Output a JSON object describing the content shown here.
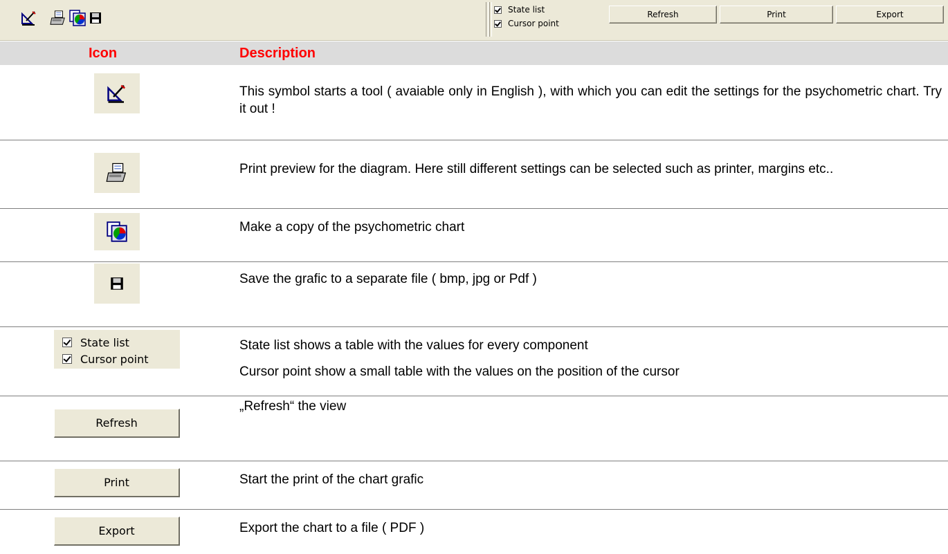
{
  "toolbar": {
    "icons": [
      "chart-settings-icon",
      "print-preview-icon",
      "copy-chart-icon",
      "save-icon"
    ],
    "checkboxes": [
      {
        "label": "State list",
        "checked": true
      },
      {
        "label": "Cursor point",
        "checked": true
      }
    ],
    "buttons": {
      "refresh": "Refresh",
      "print": "Print",
      "export": "Export"
    }
  },
  "table": {
    "headers": {
      "icon": "Icon",
      "description": "Description"
    },
    "header_color": "#ff0000",
    "rows": [
      {
        "icon": "chart-settings-icon",
        "description": "This symbol starts a tool ( avaiable only in English ), with which you can edit the settings for the psychometric chart. Try it out  !"
      },
      {
        "icon": "print-preview-icon",
        "description": "Print preview for the diagram. Here still different settings can be selected such as printer, margins  etc.."
      },
      {
        "icon": "copy-chart-icon",
        "description": "Make a copy of the psychometric chart"
      },
      {
        "icon": "save-icon",
        "description": "Save the grafic to a separate file ( bmp, jpg or Pdf )"
      },
      {
        "icon": "checkbox-group",
        "checkboxes": [
          "State list",
          "Cursor point"
        ],
        "description": "State list shows a table with the values for every component",
        "description2": "Cursor point show a small table with the values on the position of the cursor"
      },
      {
        "icon": "refresh-button",
        "button_label": "Refresh",
        "description": "„Refresh“ the view"
      },
      {
        "icon": "print-button",
        "button_label": "Print",
        "description": "Start the print of the chart grafic"
      },
      {
        "icon": "export-button",
        "button_label": "Export",
        "description": "Export the chart to a file ( PDF )"
      }
    ]
  }
}
